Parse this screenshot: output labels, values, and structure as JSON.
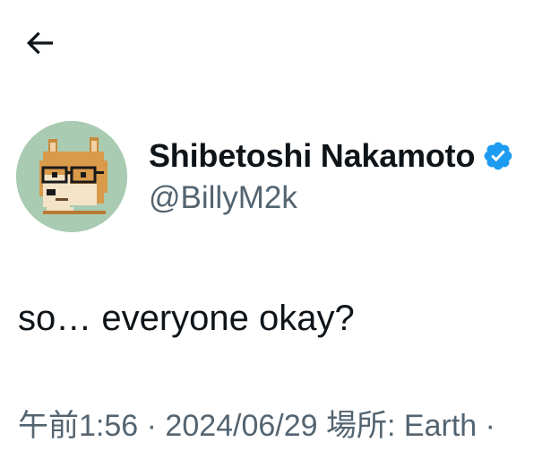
{
  "header": {
    "back_icon": "arrow-left-icon"
  },
  "author": {
    "display_name": "Shibetoshi Nakamoto",
    "handle": "@BillyM2k",
    "verified_icon": "verified-badge-icon",
    "verified_color": "#1d9bf0",
    "avatar_background": "#a9cbb1"
  },
  "tweet": {
    "text": "so… everyone okay?"
  },
  "meta": {
    "time": "午前1:56",
    "separator_1": " · ",
    "date": "2024/06/29",
    "location": " 場所: Earth",
    "separator_2": " ·"
  },
  "colors": {
    "text_primary": "#0f1419",
    "text_secondary": "#536471",
    "background": "#ffffff"
  }
}
